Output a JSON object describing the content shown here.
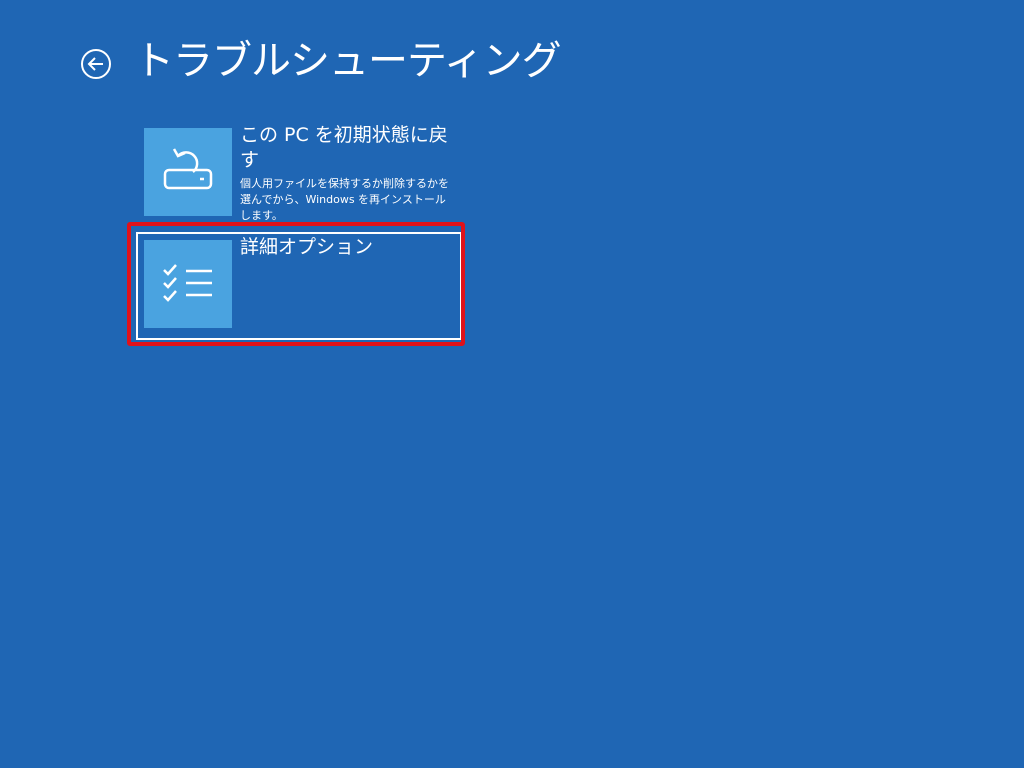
{
  "header": {
    "title": "トラブルシューティング",
    "back_icon": "back-arrow-icon"
  },
  "options": [
    {
      "title": "この PC を初期状態に戻す",
      "description": "個人用ファイルを保持するか削除するかを選んでから、Windows を再インストールします。",
      "icon": "reset-pc-icon"
    },
    {
      "title": "詳細オプション",
      "description": "",
      "icon": "checklist-icon"
    }
  ],
  "colors": {
    "background": "#1f66b4",
    "tile": "#4aa3e0",
    "focus_border": "#ffffff",
    "highlight_annotation": "#e0121b"
  }
}
